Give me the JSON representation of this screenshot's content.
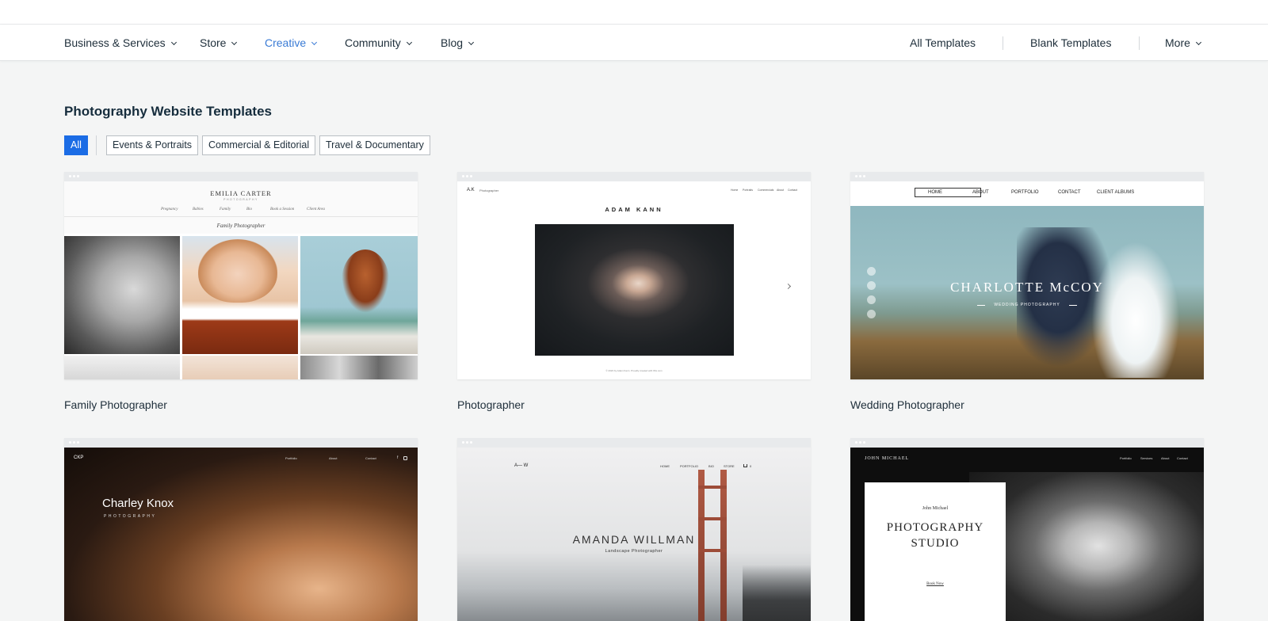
{
  "nav": {
    "items": [
      {
        "label": "Business & Services",
        "active": false
      },
      {
        "label": "Store",
        "active": false
      },
      {
        "label": "Creative",
        "active": true
      },
      {
        "label": "Community",
        "active": false
      },
      {
        "label": "Blog",
        "active": false
      }
    ],
    "right": {
      "all_templates": "All Templates",
      "blank_templates": "Blank Templates",
      "more": "More"
    }
  },
  "page": {
    "title": "Photography Website Templates"
  },
  "filters": [
    {
      "label": "All",
      "active": true
    },
    {
      "label": "Events & Portraits",
      "active": false
    },
    {
      "label": "Commercial & Editorial",
      "active": false
    },
    {
      "label": "Travel & Documentary",
      "active": false
    }
  ],
  "colors": {
    "accent": "#3a7bd5",
    "chip_active": "#1b6ce5",
    "background": "#f4f5f5",
    "text": "#20303c"
  },
  "templates": [
    {
      "title": "Family Photographer",
      "preview": {
        "site_name": "EMILIA CARTER",
        "site_sub": "PHOTOGRAPHY",
        "menu": [
          "Pregnancy",
          "Babies",
          "Family",
          "Bio",
          "Book a Session",
          "Client Area"
        ],
        "heading": "Family Photographer"
      }
    },
    {
      "title": "Photographer",
      "preview": {
        "logo": "A.K",
        "logo_sub": "Photographer",
        "menu": [
          "Home",
          "Portraits",
          "Commercials",
          "About",
          "Contact"
        ],
        "site_name": "ADAM KANN",
        "footer": "© 2023 by Adam Kann. Proudly created with Wix.com"
      }
    },
    {
      "title": "Wedding Photographer",
      "preview": {
        "menu": [
          "HOME",
          "ABOUT",
          "PORTFOLIO",
          "CONTACT",
          "CLIENT ALBUMS"
        ],
        "site_name": "CHARLOTTE McCOY",
        "site_sub": "WEDDING PHOTOGRAPHY"
      }
    },
    {
      "title": "",
      "preview": {
        "logo": "CKP",
        "menu": [
          "Portfolio",
          "About",
          "Contact"
        ],
        "site_name": "Charley Knox",
        "site_sub": "PHOTOGRAPHY"
      }
    },
    {
      "title": "",
      "preview": {
        "logo": "A— W",
        "menu": [
          "HOME",
          "PORTFOLIO",
          "BIO",
          "STORE"
        ],
        "cart_count": "0",
        "site_name": "AMANDA WILLMAN",
        "site_sub": "Landscape Photographer"
      }
    },
    {
      "title": "",
      "preview": {
        "logo": "JOHN MICHAEL",
        "menu": [
          "Portfolio",
          "Services",
          "About",
          "Contact"
        ],
        "card_name": "John Michael",
        "headline_1": "PHOTOGRAPHY",
        "headline_2": "STUDIO",
        "cta": "Book Now"
      }
    }
  ]
}
